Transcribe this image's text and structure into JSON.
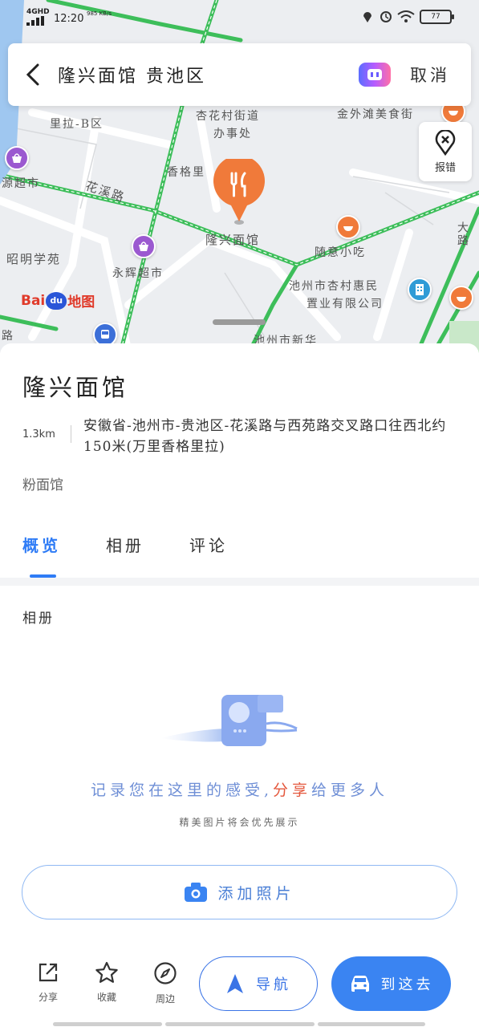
{
  "status_bar": {
    "network": "4GHD",
    "time": "12:20",
    "speed": "985 KB/s",
    "battery": "77"
  },
  "search": {
    "query": "隆兴面馆 贵池区",
    "cancel_label": "取消"
  },
  "map": {
    "report_label": "报错",
    "logo_text": "Bai地图",
    "labels": {
      "l1": "里拉-B区",
      "l2": "杏花村街道",
      "l3": "办事处",
      "l4": "金外滩美食街",
      "l5": "源超市",
      "l6": "花溪路",
      "l7": "香格里",
      "l8": "隆兴面馆",
      "l9": "随意小吃",
      "l10": "昭明学苑",
      "l11": "永辉超市",
      "l12": "池州市杏村惠民",
      "l13": "置业有限公司",
      "l14": "池州市新华",
      "l15": "路",
      "l16": "大路"
    }
  },
  "place": {
    "name": "隆兴面馆",
    "distance": "1.3km",
    "address": "安徽省-池州市-贵池区-花溪路与西苑路交叉路口往西北约150米(万里香格里拉)",
    "category": "粉面馆"
  },
  "tabs": [
    {
      "label": "概览",
      "active": true
    },
    {
      "label": "相册",
      "active": false
    },
    {
      "label": "评论",
      "active": false
    }
  ],
  "album": {
    "title": "相册",
    "prompt_part1": "记录您在这里的感受,",
    "prompt_highlight": "分享",
    "prompt_part2": "给更多人",
    "subtext": "精美图片将会优先展示",
    "add_photo_label": "添加照片"
  },
  "bottom": {
    "share_label": "分享",
    "favorite_label": "收藏",
    "nearby_label": "周边",
    "navigate_label": "导航",
    "go_label": "到这去"
  },
  "colors": {
    "accent": "#3a84f2",
    "road_green": "#3dbe5a",
    "poi_orange": "#f07a3a",
    "poi_purple": "#9b59d0"
  }
}
